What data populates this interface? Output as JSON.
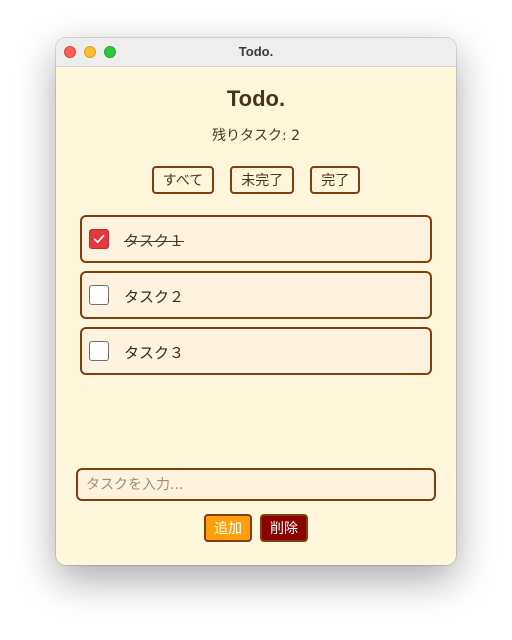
{
  "window": {
    "title": "Todo."
  },
  "app": {
    "heading": "Todo.",
    "remaining_label": "残りタスク: 2"
  },
  "filters": [
    {
      "label": "すべて"
    },
    {
      "label": "未完了"
    },
    {
      "label": "完了"
    }
  ],
  "tasks": [
    {
      "label": "タスク１",
      "completed": true
    },
    {
      "label": "タスク２",
      "completed": false
    },
    {
      "label": "タスク３",
      "completed": false
    }
  ],
  "input": {
    "value": "",
    "placeholder": "タスクを入力..."
  },
  "actions": {
    "add_label": "追加",
    "delete_label": "削除"
  },
  "colors": {
    "background": "#fff6dc",
    "border": "#7d3f0d",
    "checked": "#e0393e",
    "add_button": "#ff9f0a",
    "delete_button": "#8b0000"
  },
  "icons": {
    "check": "check-icon"
  }
}
